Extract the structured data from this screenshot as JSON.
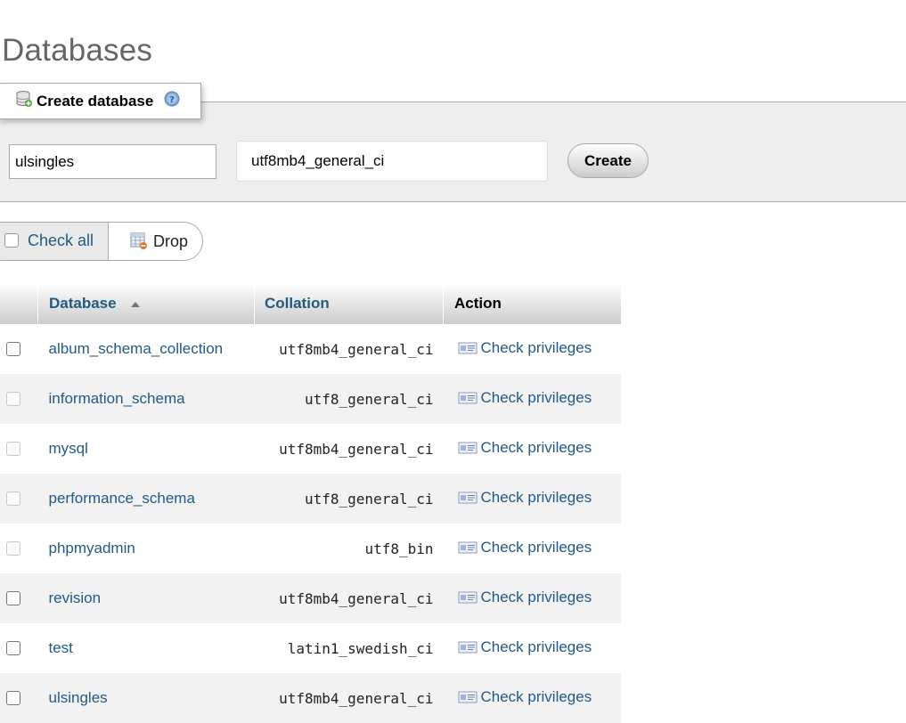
{
  "page": {
    "title": "Databases"
  },
  "create_database": {
    "legend": "Create database",
    "name_value": "ulsingles",
    "collation_value": "utf8mb4_general_ci",
    "create_label": "Create"
  },
  "bulk": {
    "check_all_label": "Check all",
    "drop_label": "Drop"
  },
  "table": {
    "headers": {
      "database": "Database",
      "collation": "Collation",
      "action": "Action"
    },
    "rows": [
      {
        "name": "album_schema_collection",
        "collation": "utf8mb4_general_ci",
        "action": "Check privileges",
        "checkable": true
      },
      {
        "name": "information_schema",
        "collation": "utf8_general_ci",
        "action": "Check privileges",
        "checkable": false
      },
      {
        "name": "mysql",
        "collation": "utf8mb4_general_ci",
        "action": "Check privileges",
        "checkable": false
      },
      {
        "name": "performance_schema",
        "collation": "utf8_general_ci",
        "action": "Check privileges",
        "checkable": false
      },
      {
        "name": "phpmyadmin",
        "collation": "utf8_bin",
        "action": "Check privileges",
        "checkable": false
      },
      {
        "name": "revision",
        "collation": "utf8mb4_general_ci",
        "action": "Check privileges",
        "checkable": true
      },
      {
        "name": "test",
        "collation": "latin1_swedish_ci",
        "action": "Check privileges",
        "checkable": true
      },
      {
        "name": "ulsingles",
        "collation": "utf8mb4_general_ci",
        "action": "Check privileges",
        "checkable": true
      }
    ]
  },
  "colors": {
    "link": "#235a81",
    "panel_bg": "#eeeeee",
    "row_alt": "#f2f2f2"
  }
}
